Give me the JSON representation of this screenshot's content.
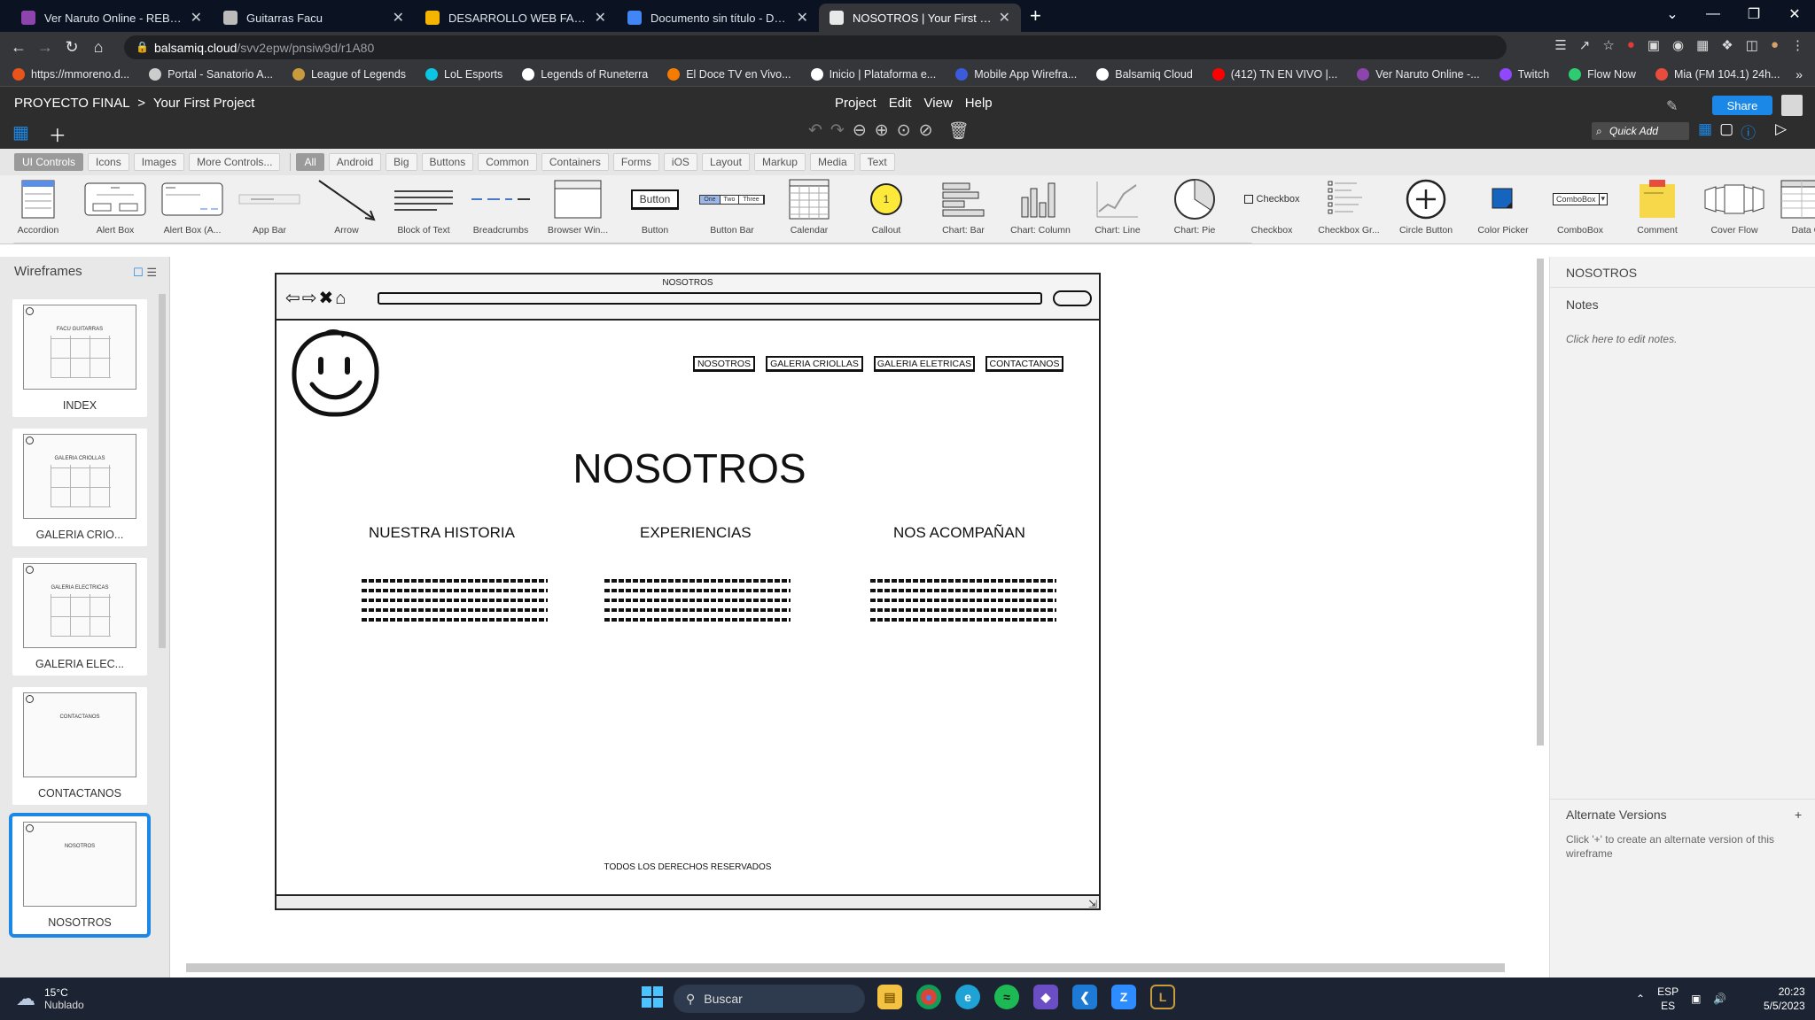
{
  "browser": {
    "tabs": [
      {
        "title": "Ver Naruto Online - REBELISPLUS",
        "color": "#8e44ad",
        "active": false
      },
      {
        "title": "Guitarras Facu",
        "color": "#bbbbbb",
        "active": false
      },
      {
        "title": "DESARROLLO WEB FACU - Goog",
        "color": "#f4b400",
        "active": false
      },
      {
        "title": "Documento sin título - Documen",
        "color": "#4285f4",
        "active": false
      },
      {
        "title": "NOSOTROS | Your First Project | B",
        "color": "#e8e8e8",
        "active": true
      }
    ],
    "url_host": "balsamiq.cloud",
    "url_path": "/svv2epw/pnsiw9d/r1A80",
    "bookmarks": [
      {
        "label": "https://mmoreno.d...",
        "color": "#e8541a"
      },
      {
        "label": "Portal - Sanatorio A...",
        "color": "#cccccc"
      },
      {
        "label": "League of Legends",
        "color": "#c89b3c"
      },
      {
        "label": "LoL Esports",
        "color": "#0bc6e3"
      },
      {
        "label": "Legends of Runeterra",
        "color": "#ffffff"
      },
      {
        "label": "El Doce TV en Vivo...",
        "color": "#f57c00"
      },
      {
        "label": "Inicio | Plataforma e...",
        "color": "#ffffff"
      },
      {
        "label": "Mobile App Wirefra...",
        "color": "#3b5bdb"
      },
      {
        "label": "Balsamiq Cloud",
        "color": "#ffffff"
      },
      {
        "label": "(412) TN EN VIVO |...",
        "color": "#ff0000"
      },
      {
        "label": "Ver Naruto Online -...",
        "color": "#8e44ad"
      },
      {
        "label": "Twitch",
        "color": "#9146ff"
      },
      {
        "label": "Flow Now",
        "color": "#2ecc71"
      },
      {
        "label": "Mia (FM 104.1) 24h...",
        "color": "#e74c3c"
      }
    ]
  },
  "app": {
    "breadcrumb_project": "PROYECTO FINAL",
    "breadcrumb_sep": ">",
    "breadcrumb_file": "Your First Project",
    "menu": [
      "Project",
      "Edit",
      "View",
      "Help"
    ],
    "share_label": "Share",
    "quick_add_placeholder": "Quick Add"
  },
  "library": {
    "tabs_left": [
      "UI Controls",
      "Icons",
      "Images",
      "More Controls..."
    ],
    "tabs_right": [
      "All",
      "Android",
      "Big",
      "Buttons",
      "Common",
      "Containers",
      "Forms",
      "iOS",
      "Layout",
      "Markup",
      "Media",
      "Text"
    ],
    "controls": [
      "Accordion",
      "Alert Box",
      "Alert Box (A...",
      "App Bar",
      "Arrow",
      "Block of Text",
      "Breadcrumbs",
      "Browser Win...",
      "Button",
      "Button Bar",
      "Calendar",
      "Callout",
      "Chart: Bar",
      "Chart: Column",
      "Chart: Line",
      "Chart: Pie",
      "Checkbox",
      "Checkbox Gr...",
      "Circle Button",
      "Color Picker",
      "ComboBox",
      "Comment",
      "Cover Flow",
      "Data Grid"
    ],
    "button_sample": "Button",
    "checkbox_sample": "Checkbox",
    "combobox_sample": "ComboBox",
    "callout_sample": "1",
    "buttonbar_samples": [
      "One",
      "Two",
      "Three"
    ]
  },
  "wireframes_panel": {
    "title": "Wireframes",
    "pages": [
      {
        "label": "INDEX",
        "thumb_title": "FACU GUITARRAS",
        "selected": false
      },
      {
        "label": "GALERIA CRIO...",
        "thumb_title": "GALERIA CRIOLLAS",
        "selected": false
      },
      {
        "label": "GALERIA ELEC...",
        "thumb_title": "GALERIA ELECTRICAS",
        "selected": false
      },
      {
        "label": "CONTACTANOS",
        "thumb_title": "CONTACTANOS",
        "selected": false
      },
      {
        "label": "NOSOTROS",
        "thumb_title": "NOSOTROS",
        "selected": true
      }
    ]
  },
  "wireframe": {
    "window_title": "NOSOTROS",
    "nav_buttons": [
      "NOSOTROS",
      "GALERIA CRIOLLAS",
      "GALERIA ELETRICAS",
      "CONTACTANOS"
    ],
    "heading": "NOSOTROS",
    "sections": [
      "NUESTRA HISTORIA",
      "EXPERIENCIAS",
      "NOS ACOMPAÑAN"
    ],
    "footer": "TODOS LOS DERECHOS RESERVADOS"
  },
  "right_panel": {
    "title": "NOSOTROS",
    "notes_label": "Notes",
    "notes_hint": "Click here to edit notes.",
    "alt_versions_label": "Alternate Versions",
    "alt_versions_add": "+",
    "alt_versions_hint": "Click '+' to create an alternate version of this wireframe"
  },
  "taskbar": {
    "temperature": "15°C",
    "weather": "Nublado",
    "search_label": "Buscar",
    "lang": "ESP",
    "lang_sub": "ES",
    "time": "20:23",
    "date": "5/5/2023"
  }
}
